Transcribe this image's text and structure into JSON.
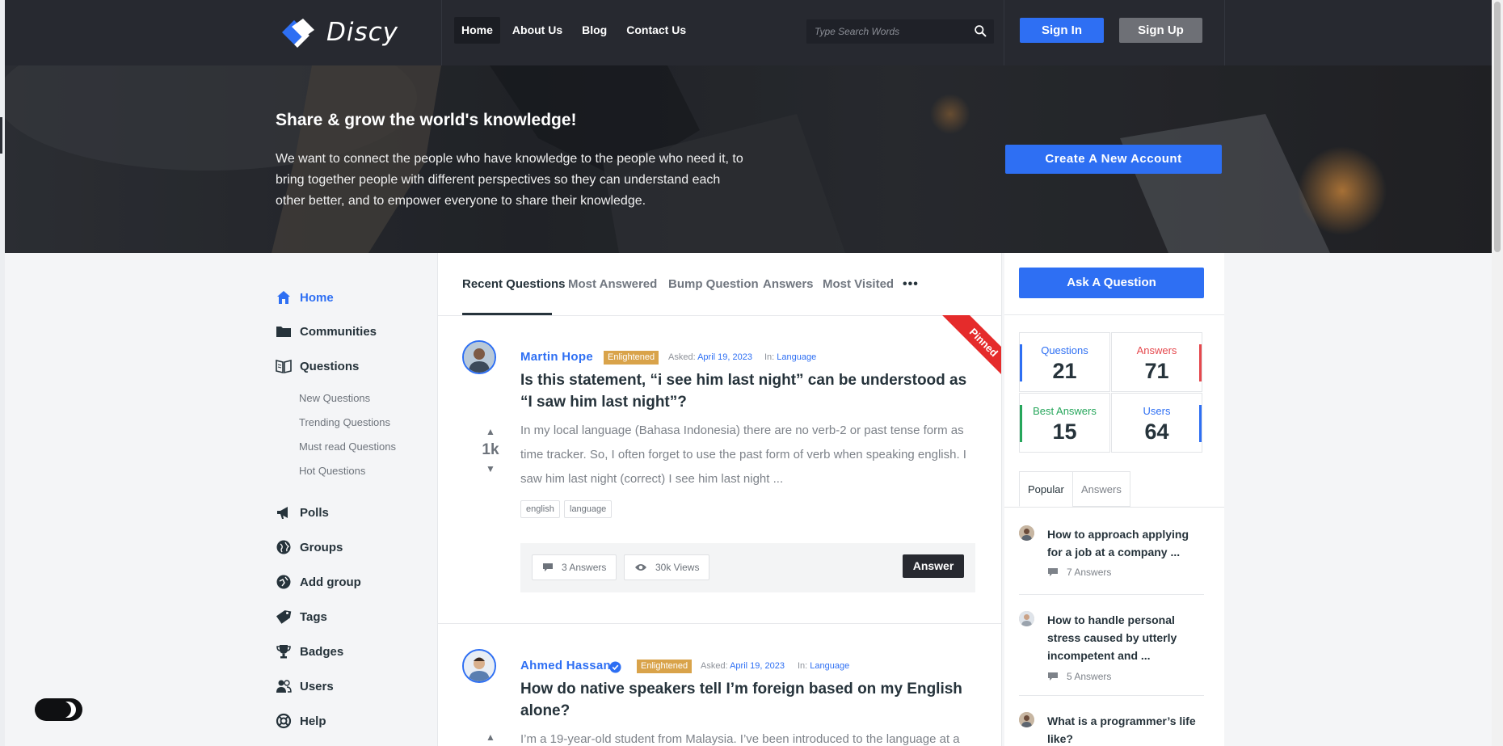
{
  "header": {
    "logo_text": "Discy",
    "nav": [
      "Home",
      "About Us",
      "Blog",
      "Contact Us"
    ],
    "search_placeholder": "Type Search Words",
    "sign_in": "Sign In",
    "sign_up": "Sign Up"
  },
  "hero": {
    "title": "Share & grow the world's knowledge!",
    "text": "We want to connect the people who have knowledge to the people who need it, to bring together people with different perspectives so they can understand each other better, and to empower everyone to share their knowledge.",
    "create_account": "Create A New Account"
  },
  "sidebar": {
    "items": [
      {
        "label": "Home",
        "icon": "home-icon"
      },
      {
        "label": "Communities",
        "icon": "folder-icon"
      },
      {
        "label": "Questions",
        "icon": "book-icon"
      },
      {
        "label": "Polls",
        "icon": "megaphone-icon"
      },
      {
        "label": "Groups",
        "icon": "globe-icon"
      },
      {
        "label": "Add group",
        "icon": "globe-plus-icon"
      },
      {
        "label": "Tags",
        "icon": "tag-icon"
      },
      {
        "label": "Badges",
        "icon": "trophy-icon"
      },
      {
        "label": "Users",
        "icon": "users-icon"
      },
      {
        "label": "Help",
        "icon": "lifebuoy-icon"
      }
    ],
    "sub_items": [
      "New Questions",
      "Trending Questions",
      "Must read Questions",
      "Hot Questions"
    ]
  },
  "tabs": [
    "Recent Questions",
    "Most Answered",
    "Bump Question",
    "Answers",
    "Most Visited"
  ],
  "tabs_more": "•••",
  "questions": [
    {
      "author": "Martin Hope",
      "badge": "Enlightened",
      "asked_label": "Asked:",
      "asked_date": "April 19, 2023",
      "in_label": "In:",
      "category": "Language",
      "title": "Is this statement, “i see him last night” can be understood as “I saw him last night”?",
      "votes": "1k",
      "excerpt": "In my local language (Bahasa Indonesia) there are no verb-2 or past tense form as time tracker. So, I often forget to use the past form of verb when speaking english. I saw him last night (correct) I see him last night ...",
      "tags": [
        "english",
        "language"
      ],
      "answers": "3 Answers",
      "views": "30k Views",
      "answer_button": "Answer",
      "pinned": "Pinned"
    },
    {
      "author": "Ahmed Hassan",
      "badge": "Enlightened",
      "asked_label": "Asked:",
      "asked_date": "April 19, 2023",
      "in_label": "In:",
      "category": "Language",
      "title": "How do native speakers tell I’m foreign based on my English alone?",
      "excerpt": "I’m a 19-year-old student from Malaysia. I’ve been introduced to the language at a"
    }
  ],
  "right": {
    "ask_button": "Ask A Question",
    "stats": [
      {
        "label": "Questions",
        "value": "21",
        "color": "#2e6ff3"
      },
      {
        "label": "Answers",
        "value": "71",
        "color": "#e5484d"
      },
      {
        "label": "Best Answers",
        "value": "15",
        "color": "#26a65b"
      },
      {
        "label": "Users",
        "value": "64",
        "color": "#2e6ff3"
      }
    ],
    "pop_tabs": [
      "Popular",
      "Answers"
    ],
    "popular": [
      {
        "title": "How to approach applying for a job at a company ...",
        "answers": "7 Answers"
      },
      {
        "title": "How to handle personal stress caused by utterly incompetent and ...",
        "answers": "5 Answers"
      },
      {
        "title": "What is a programmer’s life like?",
        "answers": ""
      }
    ]
  }
}
